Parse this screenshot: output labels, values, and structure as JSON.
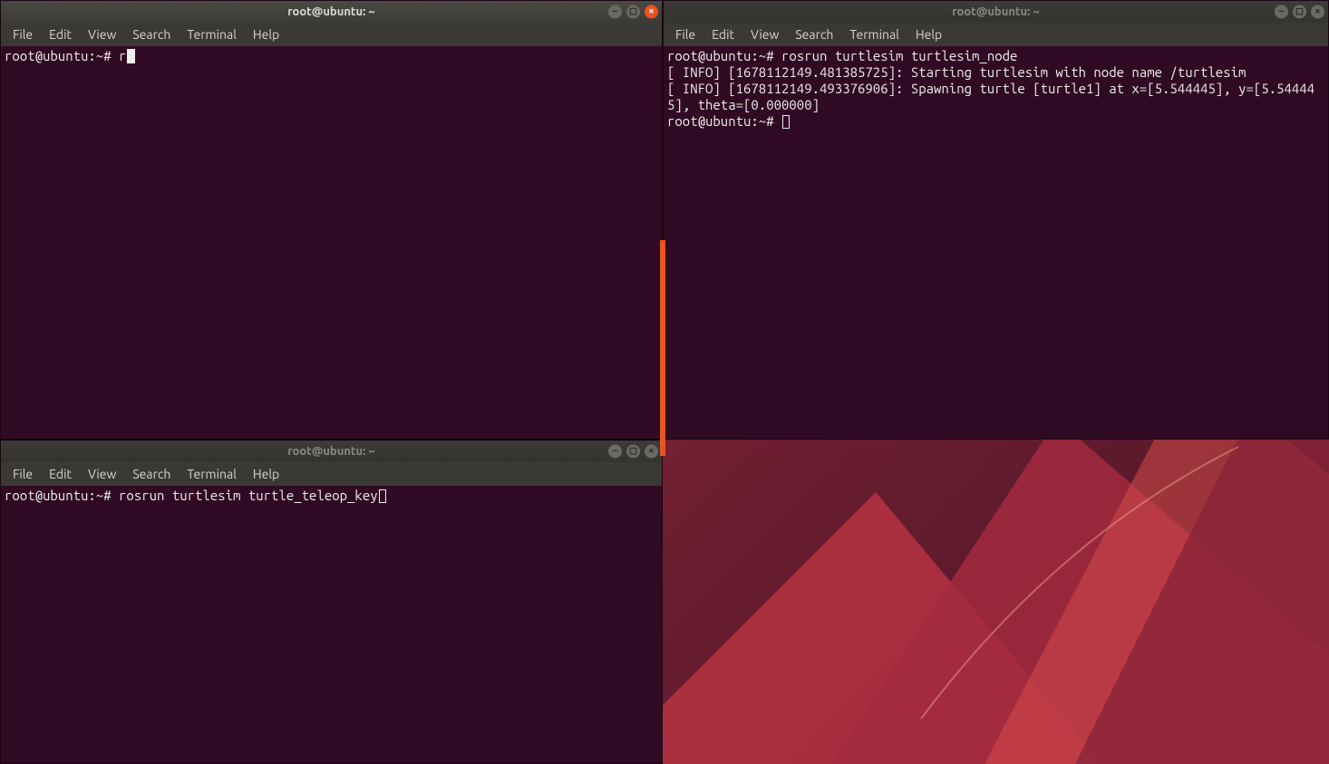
{
  "colors": {
    "terminal_bg": "#300a24",
    "titlebar_active_top": "#4a4944",
    "titlebar_active_bottom": "#3c3b37",
    "close_active": "#e95420",
    "text": "#eeeeec"
  },
  "menus": [
    "File",
    "Edit",
    "View",
    "Search",
    "Terminal",
    "Help"
  ],
  "terminals": {
    "top_left": {
      "title": "root@ubuntu: ~",
      "active": true,
      "lines": [
        {
          "prompt": "root@ubuntu:~# ",
          "input": "r",
          "cursor": "fill"
        }
      ]
    },
    "bottom_left": {
      "title": "root@ubuntu: ~",
      "active": false,
      "lines": [
        {
          "prompt": "root@ubuntu:~# ",
          "input": "rosrun turtlesim turtle_teleop_key",
          "cursor": "outline"
        }
      ]
    },
    "top_right": {
      "title": "root@ubuntu: ~",
      "active": false,
      "lines": [
        {
          "prompt": "root@ubuntu:~# ",
          "input": "rosrun turtlesim turtlesim_node",
          "cursor": "none"
        },
        {
          "text": "[ INFO] [1678112149.481385725]: Starting turtlesim with node name /turtlesim"
        },
        {
          "text": "[ INFO] [1678112149.493376906]: Spawning turtle [turtle1] at x=[5.544445], y=[5.544445], theta=[0.000000]"
        },
        {
          "prompt": "root@ubuntu:~# ",
          "input": "",
          "cursor": "outline"
        }
      ]
    }
  }
}
